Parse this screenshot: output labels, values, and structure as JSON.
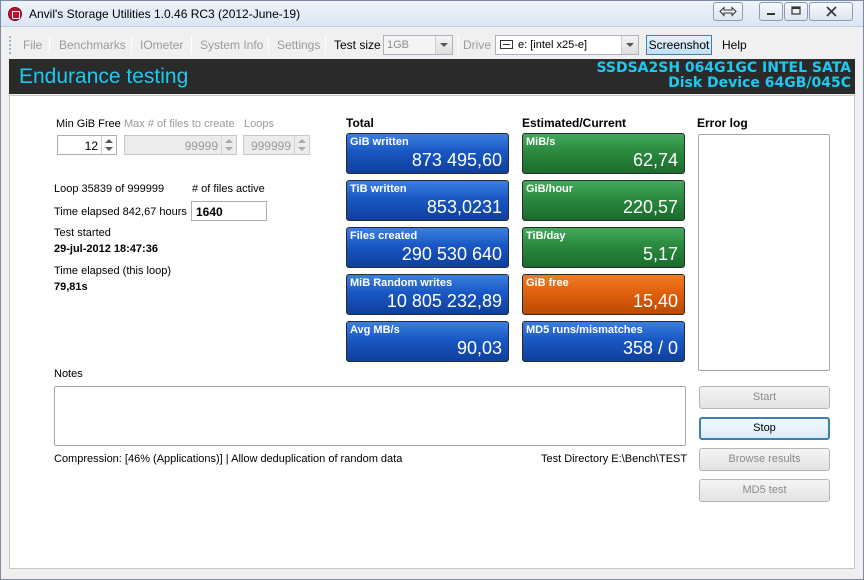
{
  "window": {
    "title": "Anvil's Storage Utilities 1.0.46 RC3 (2012-June-19)"
  },
  "toolbar": {
    "file": "File",
    "benchmarks": "Benchmarks",
    "iometer": "IOmeter",
    "system_info": "System Info",
    "settings": "Settings",
    "test_size_label": "Test size",
    "test_size_value": "1GB",
    "drive_label": "Drive",
    "drive_value": "e: [intel x25-e]",
    "screenshot": "Screenshot",
    "help": "Help"
  },
  "header": {
    "title": "Endurance testing",
    "device_line1": "SSDSA2SH 064G1GC INTEL SATA",
    "device_line2": "Disk Device 64GB/045C"
  },
  "params": {
    "min_gib_free_label": "Min GiB Free",
    "min_gib_free_value": "12",
    "max_files_label": "Max # of files to create",
    "max_files_value": "99999",
    "loops_label": "Loops",
    "loops_value": "999999"
  },
  "status": {
    "loop": "Loop 35839 of 999999",
    "files_active_label": "# of files active",
    "files_active_value": "1640",
    "time_elapsed": "Time elapsed 842,67 hours",
    "test_started_label": "Test started",
    "test_started_value": "29-jul-2012 18:47:36",
    "time_elapsed_loop_label": "Time elapsed (this loop)",
    "time_elapsed_loop_value": "79,81s"
  },
  "total": {
    "heading": "Total",
    "tiles": [
      {
        "label": "GiB written",
        "value": "873 495,60"
      },
      {
        "label": "TiB written",
        "value": "853,0231"
      },
      {
        "label": "Files created",
        "value": "290 530 640"
      },
      {
        "label": "MiB Random writes",
        "value": "10 805 232,89"
      },
      {
        "label": "Avg MB/s",
        "value": "90,03"
      }
    ]
  },
  "estimated": {
    "heading": "Estimated/Current",
    "tiles": [
      {
        "label": "MiB/s",
        "value": "62,74"
      },
      {
        "label": "GiB/hour",
        "value": "220,57"
      },
      {
        "label": "TiB/day",
        "value": "5,17"
      },
      {
        "label": "GiB free",
        "value": "15,40"
      },
      {
        "label": "MD5 runs/mismatches",
        "value": "358 / 0"
      }
    ]
  },
  "error_log": {
    "heading": "Error log"
  },
  "notes": {
    "label": "Notes"
  },
  "footer": {
    "compression": "Compression: [46% (Applications)] | Allow deduplication of random data",
    "test_directory": "Test Directory E:\\Bench\\TEST"
  },
  "buttons": {
    "start": "Start",
    "stop": "Stop",
    "browse_results": "Browse results",
    "md5_test": "MD5 test"
  },
  "colors": {
    "header_text": "#1ec9f0",
    "tile_blue": "#1958c4",
    "tile_green": "#2a8a3e",
    "tile_orange": "#e0610d"
  }
}
